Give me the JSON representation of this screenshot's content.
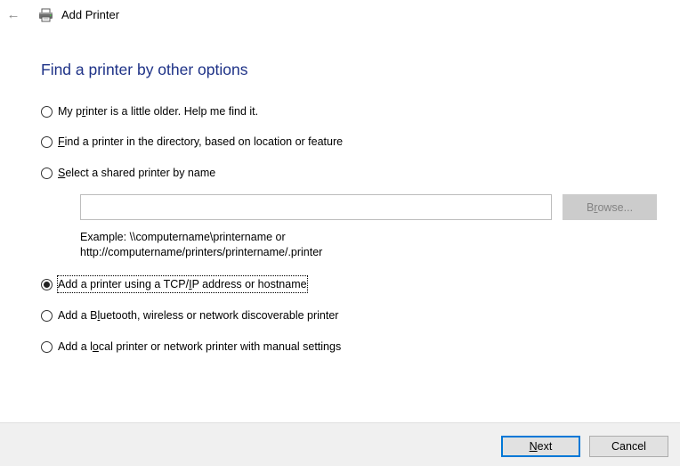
{
  "window": {
    "title": "Add Printer",
    "back_glyph": "←",
    "icons": {
      "back": "back-arrow-icon",
      "title": "printer-icon"
    }
  },
  "heading": "Find a printer by other options",
  "options": [
    {
      "pre": "My p",
      "acc": "r",
      "post": "inter is a little older. Help me find it.",
      "checked": false
    },
    {
      "pre": "",
      "acc": "F",
      "post": "ind a printer in the directory, based on location or feature",
      "checked": false
    },
    {
      "pre": "",
      "acc": "S",
      "post": "elect a shared printer by name",
      "checked": false
    },
    {
      "pre": "Add a printer using a TCP/",
      "acc": "I",
      "post": "P address or hostname",
      "checked": true
    },
    {
      "pre": "Add a B",
      "acc": "l",
      "post": "uetooth, wireless or network discoverable printer",
      "checked": false
    },
    {
      "pre": "Add a l",
      "acc": "o",
      "post": "cal printer or network printer with manual settings",
      "checked": false
    }
  ],
  "shared_printer": {
    "value": "",
    "placeholder": "",
    "browse": {
      "pre": "B",
      "acc": "r",
      "post": "owse..."
    },
    "example_line1": "Example: \\\\computername\\printername or",
    "example_line2": "http://computername/printers/printername/.printer"
  },
  "footer": {
    "next": {
      "acc": "N",
      "post": "ext"
    },
    "cancel": "Cancel"
  },
  "colors": {
    "heading": "#1e3287",
    "footer_bg": "#f0f0f0",
    "default_button_border": "#0078d7",
    "disabled_text": "#838383"
  }
}
